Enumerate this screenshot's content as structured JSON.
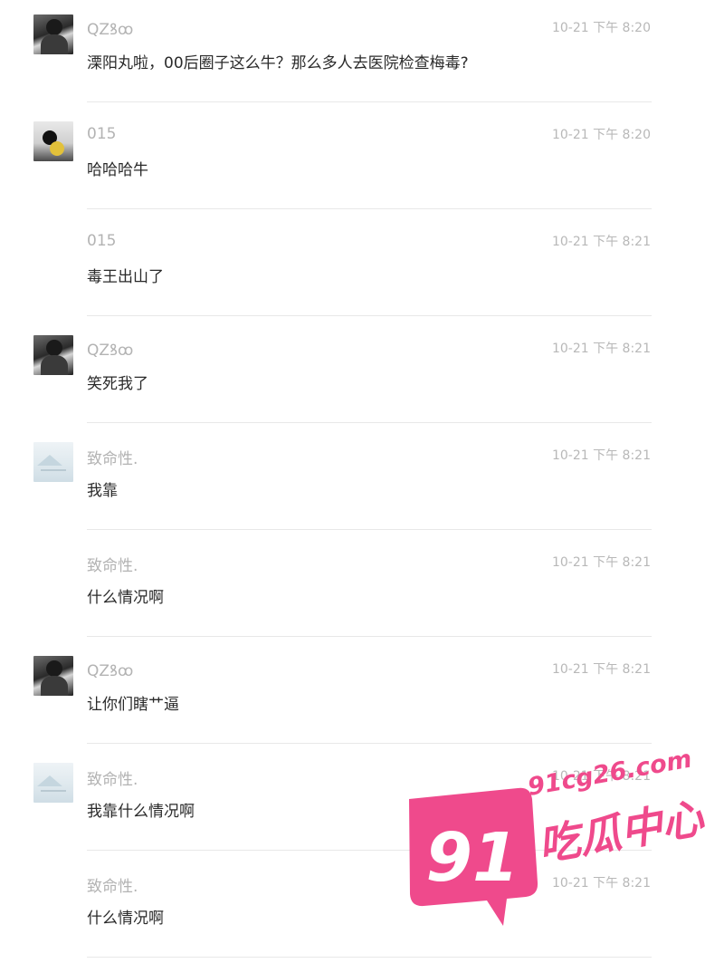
{
  "messages": [
    {
      "author": "QZꝸꝏ",
      "time": "10-21 下午 8:20",
      "text": "溧阳丸啦，00后圈子这么牛？那么多人去医院检查梅毒?",
      "avatar": "photo-avatar-man"
    },
    {
      "author": "015",
      "time": "10-21 下午 8:20",
      "text": "哈哈哈牛",
      "avatar": "photo-avatar-panda"
    },
    {
      "author": "015",
      "time": "10-21 下午 8:21",
      "text": "毒王出山了",
      "avatar": ""
    },
    {
      "author": "QZꝸꝏ",
      "time": "10-21 下午 8:21",
      "text": "笑死我了",
      "avatar": "photo-avatar-man"
    },
    {
      "author": "致命性.",
      "time": "10-21 下午 8:21",
      "text": "我靠",
      "avatar": "photo-avatar-landscape"
    },
    {
      "author": "致命性.",
      "time": "10-21 下午 8:21",
      "text": "什么情况啊",
      "avatar": ""
    },
    {
      "author": "QZꝸꝏ",
      "time": "10-21 下午 8:21",
      "text": "让你们瞎艹逼",
      "avatar": "photo-avatar-man"
    },
    {
      "author": "致命性.",
      "time": "10-21 下午 8:21",
      "text": "我靠什么情况啊",
      "avatar": "photo-avatar-landscape"
    },
    {
      "author": "致命性.",
      "time": "10-21 下午 8:21",
      "text": "什么情况啊",
      "avatar": ""
    }
  ],
  "watermark": {
    "badge": "91",
    "domain": "91cg26.com",
    "brand": "吃瓜中心",
    "color": "#ef4a8c"
  }
}
